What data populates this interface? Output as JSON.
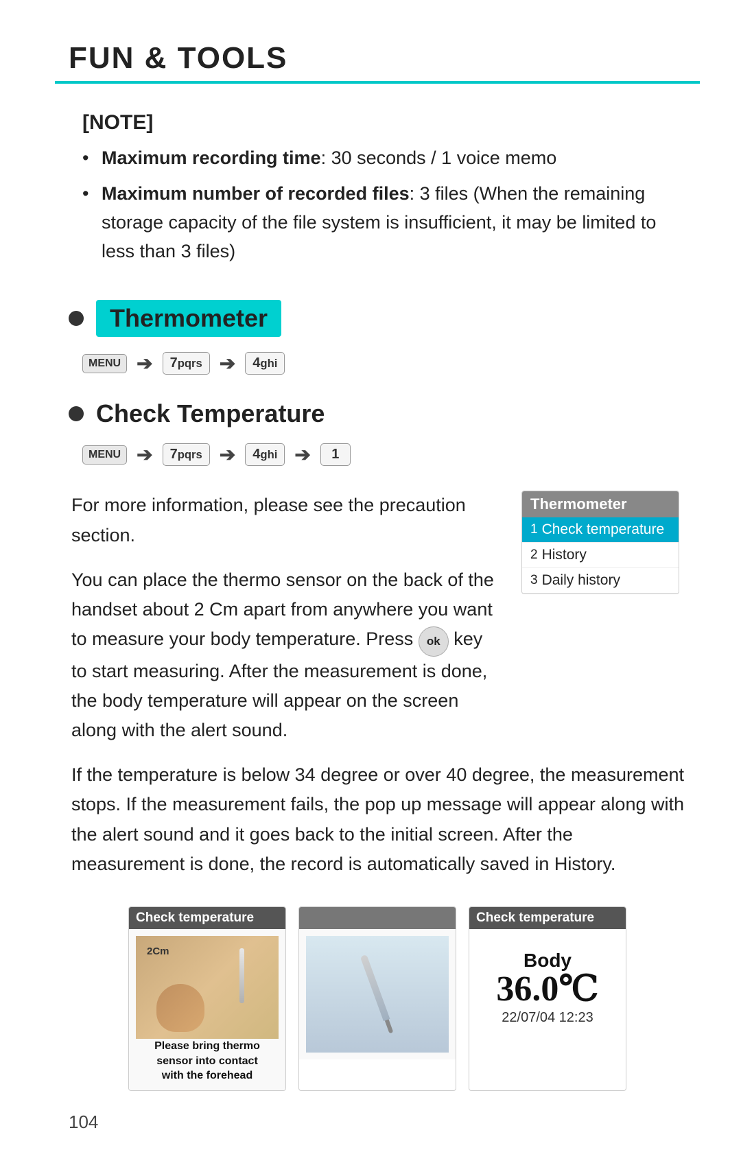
{
  "page": {
    "title": "FUN & TOOLS",
    "page_number": "104"
  },
  "note": {
    "title": "[NOTE]",
    "items": [
      {
        "bold": "Maximum recording time",
        "text": ": 30 seconds / 1 voice memo"
      },
      {
        "bold": "Maximum number of recorded files",
        "text": ": 3 files (When the remaining storage capacity of the file system is insufficient, it may be limited to less than 3 files)"
      }
    ]
  },
  "thermometer_section": {
    "heading": "Thermometer",
    "nav": [
      "MENU",
      "→",
      "7pqrs",
      "→",
      "4 ghi"
    ]
  },
  "check_temp_section": {
    "heading": "Check Temperature",
    "nav": [
      "MENU",
      "→",
      "7pqrs",
      "→",
      "4 ghi",
      "→",
      "1"
    ],
    "paragraphs": [
      "For more information, please see the precaution section.",
      "You can place the thermo sensor on the back of the handset about 2 Cm apart from anywhere you want to measure your body temperature. Press  key to start measuring. After the measurement is done, the body temperature will appear on the screen along with the alert sound.",
      "If the temperature is below 34 degree or over 40 degree, the measurement stops. If the measurement fails, the pop up message will appear along with the alert sound and it goes back to the initial screen. After the measurement is done, the record is automatically saved in History."
    ]
  },
  "phone_menu": {
    "title": "Thermometer",
    "items": [
      {
        "num": "1",
        "label": "Check temperature",
        "selected": true
      },
      {
        "num": "2",
        "label": "History",
        "selected": false
      },
      {
        "num": "3",
        "label": "Daily history",
        "selected": false
      }
    ]
  },
  "images": [
    {
      "title": "Check temperature",
      "type": "hand",
      "distance": "2Cm",
      "caption": "Please bring thermo sensor into contact with the forehead"
    },
    {
      "title": "",
      "type": "pen",
      "caption": ""
    },
    {
      "title": "Check temperature",
      "type": "result",
      "label": "Body",
      "temp": "36.0℃",
      "date": "22/07/04 12:23"
    }
  ]
}
